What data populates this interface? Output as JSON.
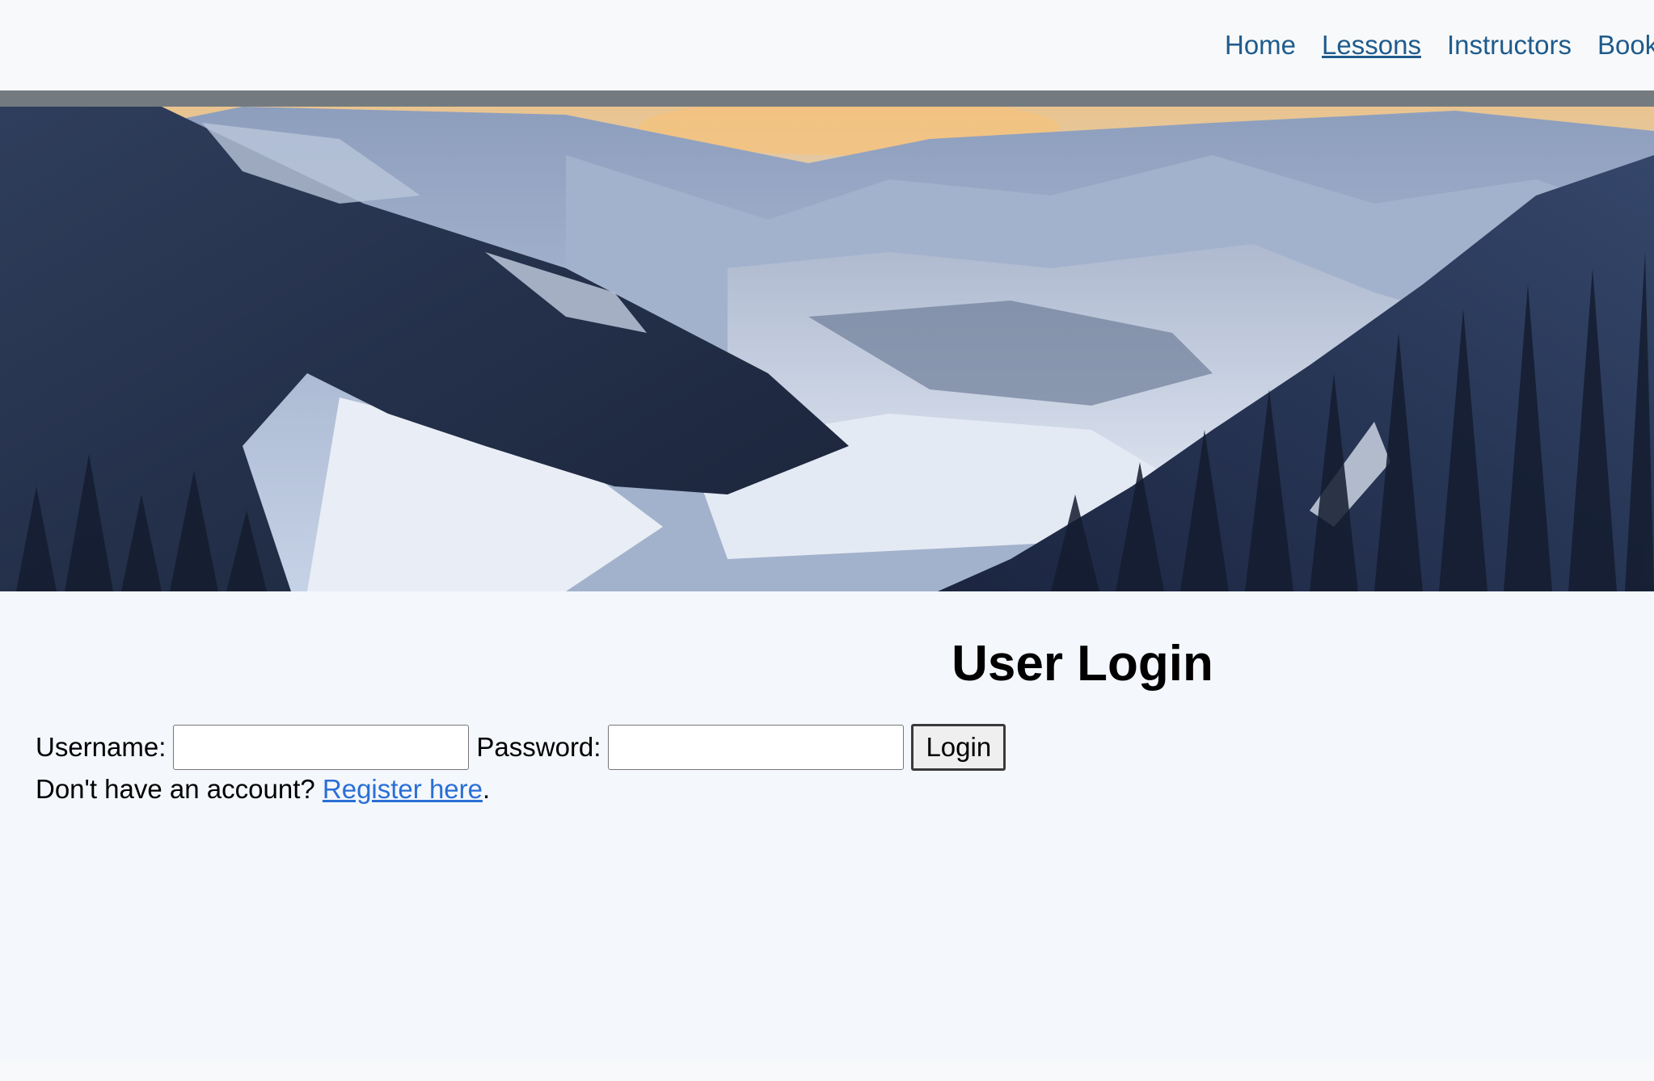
{
  "nav": {
    "items": [
      {
        "label": "Home"
      },
      {
        "label": "Lessons"
      },
      {
        "label": "Instructors"
      },
      {
        "label": "Book"
      }
    ]
  },
  "hero": {
    "image": "snowy-mountain-valley-photo"
  },
  "login": {
    "title": "User Login",
    "username_label": "Username:",
    "username_value": "",
    "password_label": "Password:",
    "password_value": "",
    "submit_label": "Login",
    "register_prompt": "Don't have an account?",
    "register_link": "Register here",
    "register_suffix": "."
  },
  "colors": {
    "nav_link": "#1f5b8c",
    "link": "#2a6fd6",
    "divider": "#747b80",
    "page_background": "#f4f7fc"
  }
}
